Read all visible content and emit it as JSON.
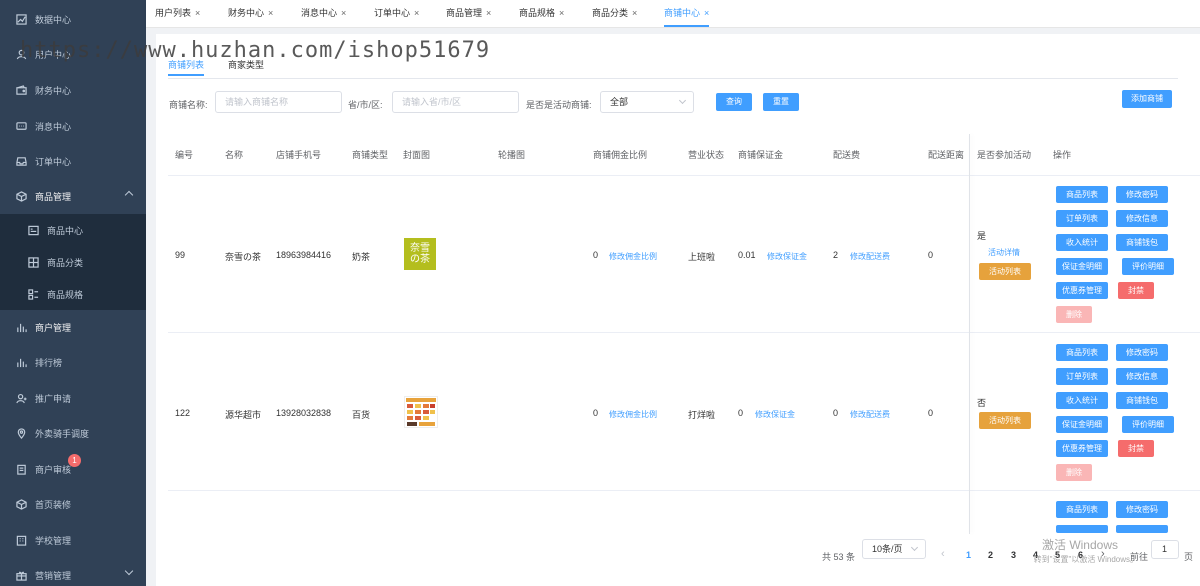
{
  "sidebar": {
    "items": [
      {
        "label": "数据中心",
        "icon": "chart-line-icon"
      },
      {
        "label": "用户中心",
        "icon": "user-icon"
      },
      {
        "label": "财务中心",
        "icon": "wallet-icon"
      },
      {
        "label": "消息中心",
        "icon": "message-icon"
      },
      {
        "label": "订单中心",
        "icon": "inbox-icon"
      },
      {
        "label": "商品管理",
        "icon": "box-icon"
      },
      {
        "label": "商品中心",
        "icon": "list-icon"
      },
      {
        "label": "商品分类",
        "icon": "grid-icon"
      },
      {
        "label": "商品规格",
        "icon": "spec-icon"
      },
      {
        "label": "商户管理",
        "icon": "bar-chart-icon"
      },
      {
        "label": "排行榜",
        "icon": "bar-chart-icon"
      },
      {
        "label": "推广申请",
        "icon": "user-add-icon"
      },
      {
        "label": "外卖骑手调度",
        "icon": "location-icon"
      },
      {
        "label": "商户审核",
        "icon": "document-icon",
        "badge": "1"
      },
      {
        "label": "首页装修",
        "icon": "box-icon"
      },
      {
        "label": "学校管理",
        "icon": "building-icon"
      },
      {
        "label": "营销管理",
        "icon": "gift-icon"
      }
    ]
  },
  "tabs": [
    {
      "label": "用户列表"
    },
    {
      "label": "财务中心"
    },
    {
      "label": "消息中心"
    },
    {
      "label": "订单中心"
    },
    {
      "label": "商品管理"
    },
    {
      "label": "商品规格"
    },
    {
      "label": "商品分类"
    },
    {
      "label": "商铺中心",
      "active": true
    }
  ],
  "tab_close": "×",
  "subtabs": {
    "first": "商铺列表",
    "second": "商家类型"
  },
  "filters": {
    "name_label": "商铺名称:",
    "name_placeholder": "请输入商铺名称",
    "region_label": "省/市/区:",
    "region_placeholder": "请输入省/市/区",
    "active_label": "是否是活动商铺:",
    "active_value": "全部",
    "query_btn": "查询",
    "reset_btn": "重置",
    "add_btn": "添加商铺"
  },
  "table": {
    "headers": [
      "编号",
      "名称",
      "店铺手机号",
      "商铺类型",
      "封面图",
      "轮播图",
      "商铺佣金比例",
      "营业状态",
      "商铺保证金",
      "配送费",
      "配送距离",
      "是否参加活动",
      "操作"
    ],
    "rows": [
      {
        "id": "99",
        "name": "奈雪の茶",
        "phone": "18963984416",
        "type": "奶茶",
        "cover_text_top": "奈雪",
        "cover_text_bottom": "の茶",
        "commission": "0",
        "commission_link": "修改佣金比例",
        "status": "上班啦",
        "deposit": "0.01",
        "deposit_link": "修改保证金",
        "fee": "2",
        "fee_link": "修改配送费",
        "distance": "0",
        "activity": "是",
        "activity_detail": "活动详情",
        "activity_list": "活动列表"
      },
      {
        "id": "122",
        "name": "源华超市",
        "phone": "13928032838",
        "type": "百货",
        "commission": "0",
        "commission_link": "修改佣金比例",
        "status": "打烊啦",
        "deposit": "0",
        "deposit_link": "修改保证金",
        "fee": "0",
        "fee_link": "修改配送费",
        "distance": "0",
        "activity": "否",
        "activity_list": "活动列表"
      }
    ],
    "actions": {
      "goods_list": "商品列表",
      "change_pwd": "修改密码",
      "order_list": "订单列表",
      "edit_info": "修改信息",
      "income_stats": "收入统计",
      "shop_wallet": "商铺钱包",
      "deposit_detail": "保证金明细",
      "review_detail": "评价明细",
      "coupon_mgmt": "优惠券管理",
      "ban": "封禁",
      "delete": "删除"
    }
  },
  "pagination": {
    "total": "共 53 条",
    "page_size": "10条/页",
    "pages": [
      "1",
      "2",
      "3",
      "4",
      "5",
      "6"
    ],
    "current": "1",
    "goto_label": "前往",
    "goto_value": "1",
    "page_unit": "页",
    "prev": "‹",
    "next": "›"
  },
  "overlay": {
    "watermark": "https://www.huzhan.com/ishop51679",
    "windows_line1": "激活 Windows",
    "windows_line2": "转到\"设置\"以激活 Windows。"
  },
  "colors": {
    "primary": "#409eff",
    "danger": "#f56c6c",
    "warning": "#e6a23c",
    "sidebar": "#304156"
  }
}
